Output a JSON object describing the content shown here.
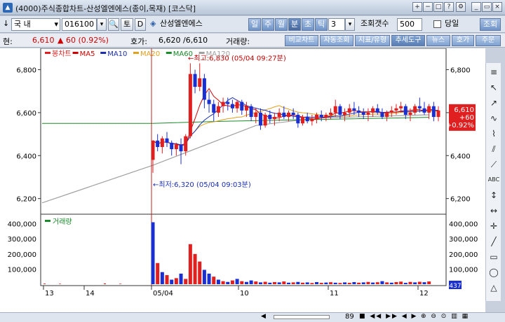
{
  "window": {
    "title": "(4000)주식종합차트-산성엘엔에스(종이,목재) [코스닥]",
    "buttons": [
      "+",
      "−",
      "□",
      "?",
      "_",
      "▭",
      "×"
    ]
  },
  "toolbar": {
    "market_label": "국 내",
    "code_value": "016100",
    "stock_name": "산성엘엔에스",
    "period_buttons": [
      "일",
      "주",
      "월",
      "분",
      "초",
      "틱"
    ],
    "active_period": "분",
    "interval_value": "3",
    "count_label": "조회갯수",
    "count_value": "500",
    "today_label": "당일",
    "search_label": "조회",
    "t_label": "토",
    "d_label": "D"
  },
  "quote": {
    "current_label": "현:",
    "current_value": "6,610",
    "change_value": "▲ 60 (0.92%)",
    "ask_label": "호가:",
    "ask_value": "6,620 /6,610",
    "volume_label": "거래량:",
    "tabs": [
      "비교차트",
      "자동조회",
      "지표/유형",
      "추세도구",
      "뉴스",
      "호가",
      "주문"
    ],
    "active_tab": "추세도구"
  },
  "chart_data": {
    "type": "candlestick",
    "legend": [
      "봉차트",
      "MA5",
      "MA10",
      "MA20",
      "MA60",
      "MA120"
    ],
    "legend_colors": [
      "#e02020",
      "#d00000",
      "#1a2fb0",
      "#e0a020",
      "#1a8a2a",
      "#a0a0a0"
    ],
    "y_ticks": [
      "6,800",
      "6,600",
      "6,400",
      "6,200"
    ],
    "ylim": [
      6150,
      6880
    ],
    "x_ticks": [
      "13",
      "14",
      "05/04",
      "10",
      "11",
      "12"
    ],
    "high_annotation": "←최고:6,830 (05/04 09:27분)",
    "low_annotation": "←최저:6,320 (05/04 09:03분)",
    "last_price": "6,610",
    "last_change": "+60",
    "last_pct": "+0.92%",
    "volume_legend": "거래량",
    "volume_ticks": [
      "400,000",
      "300,000",
      "200,000",
      "100,000"
    ],
    "volume_ylim": [
      0,
      440000
    ],
    "volume_badge": "437",
    "candles": [
      {
        "o": 6380,
        "h": 6470,
        "l": 6320,
        "c": 6470
      },
      {
        "o": 6470,
        "h": 6500,
        "l": 6420,
        "c": 6440
      },
      {
        "o": 6440,
        "h": 6490,
        "l": 6410,
        "c": 6480
      },
      {
        "o": 6480,
        "h": 6510,
        "l": 6440,
        "c": 6460
      },
      {
        "o": 6460,
        "h": 6470,
        "l": 6400,
        "c": 6430
      },
      {
        "o": 6430,
        "h": 6460,
        "l": 6400,
        "c": 6450
      },
      {
        "o": 6450,
        "h": 6480,
        "l": 6360,
        "c": 6420
      },
      {
        "o": 6420,
        "h": 6500,
        "l": 6400,
        "c": 6490
      },
      {
        "o": 6490,
        "h": 6830,
        "l": 6480,
        "c": 6780
      },
      {
        "o": 6780,
        "h": 6800,
        "l": 6690,
        "c": 6720
      },
      {
        "o": 6720,
        "h": 6830,
        "l": 6700,
        "c": 6760
      },
      {
        "o": 6760,
        "h": 6780,
        "l": 6620,
        "c": 6660
      },
      {
        "o": 6660,
        "h": 6700,
        "l": 6600,
        "c": 6640
      },
      {
        "o": 6640,
        "h": 6660,
        "l": 6560,
        "c": 6600
      },
      {
        "o": 6600,
        "h": 6650,
        "l": 6580,
        "c": 6630
      },
      {
        "o": 6630,
        "h": 6670,
        "l": 6600,
        "c": 6650
      },
      {
        "o": 6650,
        "h": 6670,
        "l": 6610,
        "c": 6640
      },
      {
        "o": 6640,
        "h": 6660,
        "l": 6600,
        "c": 6620
      },
      {
        "o": 6620,
        "h": 6660,
        "l": 6600,
        "c": 6650
      },
      {
        "o": 6650,
        "h": 6660,
        "l": 6590,
        "c": 6610
      },
      {
        "o": 6610,
        "h": 6650,
        "l": 6580,
        "c": 6630
      },
      {
        "o": 6630,
        "h": 6640,
        "l": 6560,
        "c": 6580
      },
      {
        "o": 6580,
        "h": 6620,
        "l": 6550,
        "c": 6600
      },
      {
        "o": 6600,
        "h": 6620,
        "l": 6520,
        "c": 6540
      },
      {
        "o": 6540,
        "h": 6600,
        "l": 6530,
        "c": 6590
      },
      {
        "o": 6590,
        "h": 6610,
        "l": 6550,
        "c": 6570
      },
      {
        "o": 6570,
        "h": 6600,
        "l": 6540,
        "c": 6580
      },
      {
        "o": 6580,
        "h": 6620,
        "l": 6560,
        "c": 6600
      },
      {
        "o": 6600,
        "h": 6630,
        "l": 6570,
        "c": 6580
      },
      {
        "o": 6580,
        "h": 6610,
        "l": 6560,
        "c": 6600
      },
      {
        "o": 6600,
        "h": 6620,
        "l": 6570,
        "c": 6590
      },
      {
        "o": 6590,
        "h": 6600,
        "l": 6530,
        "c": 6550
      },
      {
        "o": 6550,
        "h": 6590,
        "l": 6540,
        "c": 6580
      },
      {
        "o": 6580,
        "h": 6600,
        "l": 6550,
        "c": 6560
      },
      {
        "o": 6560,
        "h": 6590,
        "l": 6540,
        "c": 6570
      },
      {
        "o": 6570,
        "h": 6600,
        "l": 6550,
        "c": 6590
      },
      {
        "o": 6590,
        "h": 6610,
        "l": 6560,
        "c": 6580
      },
      {
        "o": 6580,
        "h": 6600,
        "l": 6560,
        "c": 6590
      },
      {
        "o": 6590,
        "h": 6620,
        "l": 6570,
        "c": 6600
      },
      {
        "o": 6600,
        "h": 6660,
        "l": 6580,
        "c": 6630
      },
      {
        "o": 6630,
        "h": 6640,
        "l": 6570,
        "c": 6590
      },
      {
        "o": 6590,
        "h": 6620,
        "l": 6560,
        "c": 6600
      },
      {
        "o": 6600,
        "h": 6640,
        "l": 6580,
        "c": 6620
      },
      {
        "o": 6620,
        "h": 6650,
        "l": 6590,
        "c": 6610
      },
      {
        "o": 6610,
        "h": 6630,
        "l": 6580,
        "c": 6600
      },
      {
        "o": 6600,
        "h": 6620,
        "l": 6570,
        "c": 6590
      },
      {
        "o": 6590,
        "h": 6620,
        "l": 6560,
        "c": 6600
      },
      {
        "o": 6600,
        "h": 6630,
        "l": 6580,
        "c": 6620
      },
      {
        "o": 6620,
        "h": 6640,
        "l": 6590,
        "c": 6600
      },
      {
        "o": 6600,
        "h": 6620,
        "l": 6570,
        "c": 6580
      },
      {
        "o": 6580,
        "h": 6610,
        "l": 6560,
        "c": 6600
      },
      {
        "o": 6600,
        "h": 6630,
        "l": 6580,
        "c": 6610
      },
      {
        "o": 6610,
        "h": 6640,
        "l": 6590,
        "c": 6620
      },
      {
        "o": 6620,
        "h": 6650,
        "l": 6600,
        "c": 6630
      },
      {
        "o": 6630,
        "h": 6640,
        "l": 6570,
        "c": 6590
      },
      {
        "o": 6590,
        "h": 6620,
        "l": 6560,
        "c": 6600
      },
      {
        "o": 6600,
        "h": 6640,
        "l": 6590,
        "c": 6630
      },
      {
        "o": 6630,
        "h": 6670,
        "l": 6600,
        "c": 6620
      },
      {
        "o": 6620,
        "h": 6650,
        "l": 6590,
        "c": 6600
      },
      {
        "o": 6600,
        "h": 6640,
        "l": 6570,
        "c": 6630
      },
      {
        "o": 6630,
        "h": 6650,
        "l": 6560,
        "c": 6580
      },
      {
        "o": 6580,
        "h": 6630,
        "l": 6560,
        "c": 6610
      }
    ],
    "volume": [
      {
        "v": 410000,
        "up": false
      },
      {
        "v": 140000,
        "up": true
      },
      {
        "v": 80000,
        "up": false
      },
      {
        "v": 60000,
        "up": true
      },
      {
        "v": 30000,
        "up": false
      },
      {
        "v": 40000,
        "up": true
      },
      {
        "v": 70000,
        "up": false
      },
      {
        "v": 35000,
        "up": true
      },
      {
        "v": 265000,
        "up": true
      },
      {
        "v": 200000,
        "up": true
      },
      {
        "v": 150000,
        "up": true
      },
      {
        "v": 95000,
        "up": false
      },
      {
        "v": 70000,
        "up": false
      },
      {
        "v": 50000,
        "up": true
      },
      {
        "v": 30000,
        "up": false
      },
      {
        "v": 20000,
        "up": true
      },
      {
        "v": 15000,
        "up": false
      },
      {
        "v": 25000,
        "up": true
      },
      {
        "v": 35000,
        "up": false
      },
      {
        "v": 20000,
        "up": true
      },
      {
        "v": 15000,
        "up": false
      },
      {
        "v": 25000,
        "up": false
      },
      {
        "v": 18000,
        "up": true
      },
      {
        "v": 12000,
        "up": false
      },
      {
        "v": 16000,
        "up": true
      },
      {
        "v": 10000,
        "up": false
      },
      {
        "v": 14000,
        "up": true
      },
      {
        "v": 12000,
        "up": false
      },
      {
        "v": 18000,
        "up": true
      },
      {
        "v": 10000,
        "up": false
      },
      {
        "v": 12000,
        "up": true
      },
      {
        "v": 15000,
        "up": false
      },
      {
        "v": 10000,
        "up": true
      },
      {
        "v": 12000,
        "up": false
      },
      {
        "v": 8000,
        "up": true
      },
      {
        "v": 14000,
        "up": false
      },
      {
        "v": 9000,
        "up": true
      },
      {
        "v": 11000,
        "up": false
      },
      {
        "v": 13000,
        "up": true
      },
      {
        "v": 10000,
        "up": false
      },
      {
        "v": 8000,
        "up": true
      },
      {
        "v": 12000,
        "up": false
      },
      {
        "v": 9000,
        "up": true
      },
      {
        "v": 14000,
        "up": false
      },
      {
        "v": 10000,
        "up": true
      },
      {
        "v": 12000,
        "up": false
      },
      {
        "v": 15000,
        "up": true
      },
      {
        "v": 11000,
        "up": false
      },
      {
        "v": 13000,
        "up": true
      },
      {
        "v": 20000,
        "up": false
      },
      {
        "v": 12000,
        "up": true
      },
      {
        "v": 10000,
        "up": false
      },
      {
        "v": 14000,
        "up": true
      },
      {
        "v": 17000,
        "up": true
      },
      {
        "v": 9000,
        "up": false
      },
      {
        "v": 15000,
        "up": true
      },
      {
        "v": 12000,
        "up": false
      },
      {
        "v": 16000,
        "up": true
      },
      {
        "v": 13000,
        "up": false
      },
      {
        "v": 18000,
        "up": true
      }
    ]
  },
  "status": {
    "zoom_value": "89"
  }
}
